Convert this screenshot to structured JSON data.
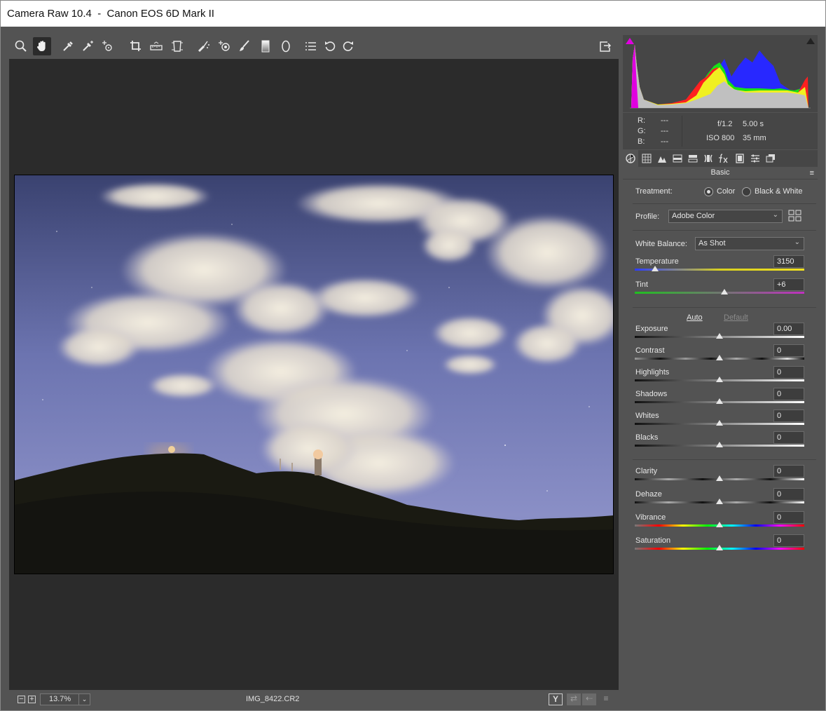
{
  "window": {
    "title": "Camera Raw 10.4  -  Canon EOS 6D Mark II"
  },
  "toolbar": {
    "tools": [
      "zoom-icon",
      "hand-icon",
      "white-balance-icon",
      "color-sampler-icon",
      "targeted-adjustment-icon",
      "crop-icon",
      "straighten-icon",
      "transform-icon",
      "spot-removal-icon",
      "red-eye-icon",
      "adjustment-brush-icon",
      "graduated-filter-icon",
      "radial-filter-icon",
      "presets-list-icon",
      "rotate-ccw-icon",
      "rotate-cw-icon"
    ],
    "active_tool": "hand-icon",
    "toggle_fullscreen": "fullscreen-toggle-icon"
  },
  "statusbar": {
    "zoom_out": "−",
    "zoom_in": "+",
    "zoom_level": "13.7%",
    "filename": "IMG_8422.CR2",
    "before_after_label": "Y"
  },
  "info": {
    "r_label": "R:",
    "g_label": "G:",
    "b_label": "B:",
    "r_value": "---",
    "g_value": "---",
    "b_value": "---",
    "aperture": "f/1.2",
    "shutter": "5.00 s",
    "iso": "ISO 800",
    "focal": "35 mm"
  },
  "panel": {
    "title": "Basic",
    "tabs": [
      "basic-tab-icon",
      "tone-curve-tab-icon",
      "detail-tab-icon",
      "hsl-tab-icon",
      "split-toning-tab-icon",
      "lens-corrections-tab-icon",
      "effects-tab-icon",
      "camera-calibration-tab-icon",
      "presets-tab-icon",
      "snapshots-tab-icon"
    ],
    "treatment_label": "Treatment:",
    "treatment_color": "Color",
    "treatment_bw": "Black & White",
    "treatment_selected": "Color",
    "profile_label": "Profile:",
    "profile_value": "Adobe Color",
    "wb_label": "White Balance:",
    "wb_value": "As Shot",
    "auto_label": "Auto",
    "default_label": "Default",
    "sliders": {
      "temperature": {
        "label": "Temperature",
        "value": "3150",
        "pos": 0.12
      },
      "tint": {
        "label": "Tint",
        "value": "+6",
        "pos": 0.53
      },
      "exposure": {
        "label": "Exposure",
        "value": "0.00",
        "pos": 0.5
      },
      "contrast": {
        "label": "Contrast",
        "value": "0",
        "pos": 0.5
      },
      "highlights": {
        "label": "Highlights",
        "value": "0",
        "pos": 0.5
      },
      "shadows": {
        "label": "Shadows",
        "value": "0",
        "pos": 0.5
      },
      "whites": {
        "label": "Whites",
        "value": "0",
        "pos": 0.5
      },
      "blacks": {
        "label": "Blacks",
        "value": "0",
        "pos": 0.5
      },
      "clarity": {
        "label": "Clarity",
        "value": "0",
        "pos": 0.5
      },
      "dehaze": {
        "label": "Dehaze",
        "value": "0",
        "pos": 0.5
      },
      "vibrance": {
        "label": "Vibrance",
        "value": "0",
        "pos": 0.5
      },
      "saturation": {
        "label": "Saturation",
        "value": "0",
        "pos": 0.5
      }
    }
  },
  "colors": {
    "chrome": "#535353",
    "canvas": "#2b2b2b",
    "panel_dark": "#464646",
    "clip_shadow": "#e000e0"
  }
}
